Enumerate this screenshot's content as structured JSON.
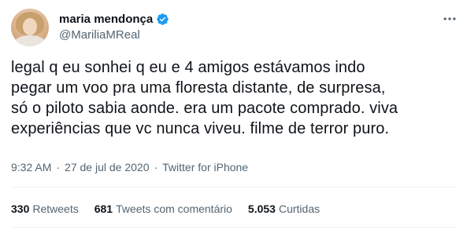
{
  "author": {
    "display_name": "maria mendonça",
    "handle": "@MariliaMReal",
    "verified": true
  },
  "tweet": {
    "text": "legal q eu sonhei q eu e 4 amigos estávamos indo\npegar um voo pra uma floresta distante, de surpresa,\nsó o piloto sabia aonde. era um pacote comprado. viva\nexperiências que vc nunca viveu. filme de terror puro.",
    "time": "9:32 AM",
    "separator": "·",
    "date": "27 de jul de 2020",
    "source": "Twitter for iPhone"
  },
  "stats": {
    "retweets_count": "330",
    "retweets_label": "Retweets",
    "quotes_count": "681",
    "quotes_label": "Tweets com comentário",
    "likes_count": "5.053",
    "likes_label": "Curtidas"
  },
  "icons": {
    "verified": "verified-badge-icon",
    "more": "more-options-icon"
  },
  "colors": {
    "text_primary": "#0f1419",
    "text_secondary": "#536471",
    "verified_blue": "#1d9bf0",
    "divider": "#eff3f4"
  }
}
